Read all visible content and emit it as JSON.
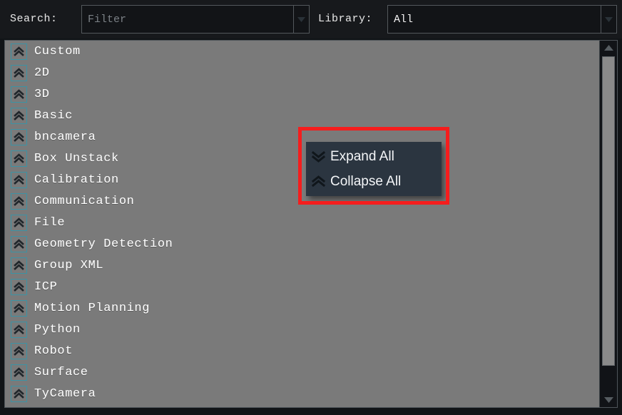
{
  "toolbar": {
    "search_label": "Search:",
    "search_placeholder": "Filter",
    "search_value": "",
    "library_label": "Library:",
    "library_value": "All",
    "dropdown_icon": "chevron-down-icon"
  },
  "tree": {
    "collapse_icon": "double-chevron-up-icon",
    "items": [
      {
        "label": "Custom"
      },
      {
        "label": "2D"
      },
      {
        "label": "3D"
      },
      {
        "label": "Basic"
      },
      {
        "label": "bncamera"
      },
      {
        "label": "Box Unstack"
      },
      {
        "label": "Calibration"
      },
      {
        "label": "Communication"
      },
      {
        "label": "File"
      },
      {
        "label": "Geometry Detection"
      },
      {
        "label": "Group XML"
      },
      {
        "label": "ICP"
      },
      {
        "label": "Motion Planning"
      },
      {
        "label": "Python"
      },
      {
        "label": "Robot"
      },
      {
        "label": "Surface"
      },
      {
        "label": "TyCamera"
      }
    ]
  },
  "scrollbar": {
    "up_icon": "arrow-up-icon",
    "down_icon": "arrow-down-icon"
  },
  "context_menu": {
    "items": [
      {
        "label": "Expand All",
        "icon": "double-chevron-down-icon"
      },
      {
        "label": "Collapse All",
        "icon": "double-chevron-up-icon"
      }
    ]
  },
  "colors": {
    "highlight": "#f51d1d",
    "menu_background": "#2b3540",
    "list_background": "#7a7a7a",
    "icon_border": "#3b93a5",
    "toolbar_background": "#17191c"
  }
}
